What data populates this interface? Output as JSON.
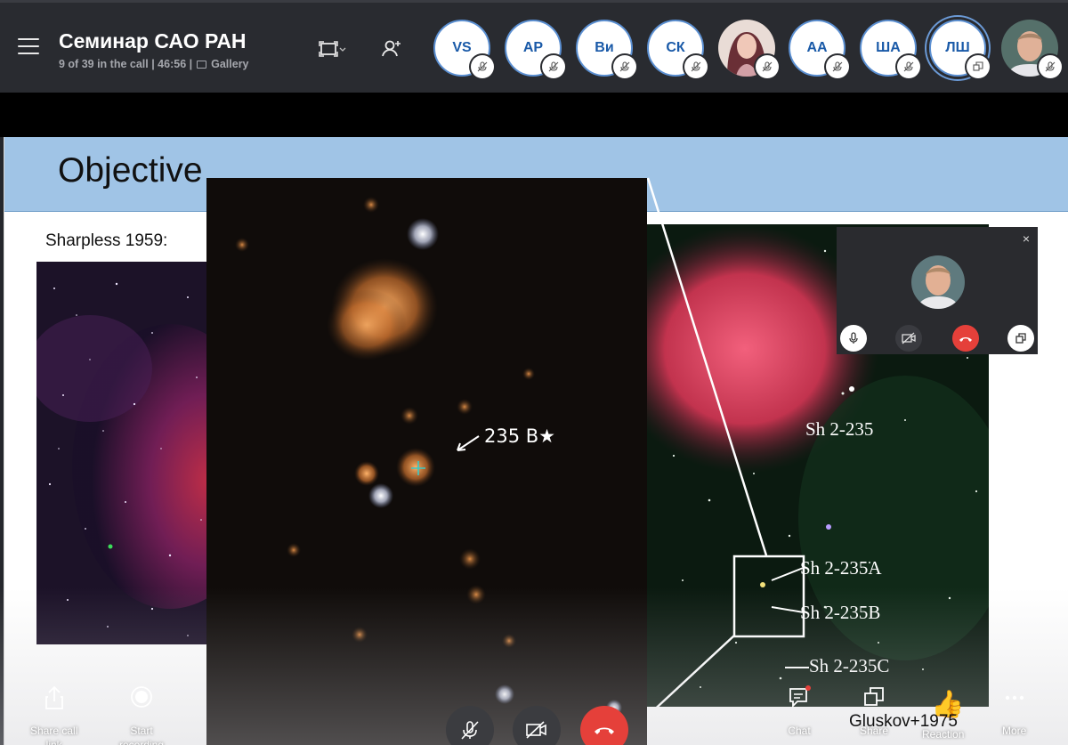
{
  "call": {
    "title": "Семинар САО РАН",
    "meta": "9 of 39 in the call | 46:56 |",
    "view_label": "Gallery"
  },
  "participants": [
    {
      "initials": "VS",
      "muted": true
    },
    {
      "initials": "АР",
      "muted": true
    },
    {
      "initials": "Ви",
      "muted": true
    },
    {
      "initials": "СК",
      "muted": true
    },
    {
      "initials": "",
      "photo": true,
      "muted": true
    },
    {
      "initials": "АА",
      "muted": true
    },
    {
      "initials": "ША",
      "muted": true
    },
    {
      "initials": "ЛШ",
      "active": true
    },
    {
      "initials": "",
      "photo": true,
      "muted": true
    }
  ],
  "slide": {
    "title": "Objective",
    "caption": "Sharpless 1959:",
    "zoom_annotation": "235 B★",
    "labels": [
      "Sh 2-235",
      "Sh 2-235A",
      "Sh 2-235B",
      "Sh 2-235C"
    ]
  },
  "selfview": {
    "close_symbol": "×"
  },
  "controls": {
    "share_call_link": "Share call",
    "share_call_link_2": "link",
    "start_recording": "Start",
    "start_recording_2": "recording",
    "chat": "Chat",
    "share": "Share",
    "reaction": "Reaction",
    "more": "More"
  },
  "speaker_name": "Gluskov+1975",
  "colors": {
    "topbar": "#292b30",
    "accent_blue": "#1a5aa8",
    "end_call": "#e5403a",
    "slide_header": "#a0c4e6"
  }
}
